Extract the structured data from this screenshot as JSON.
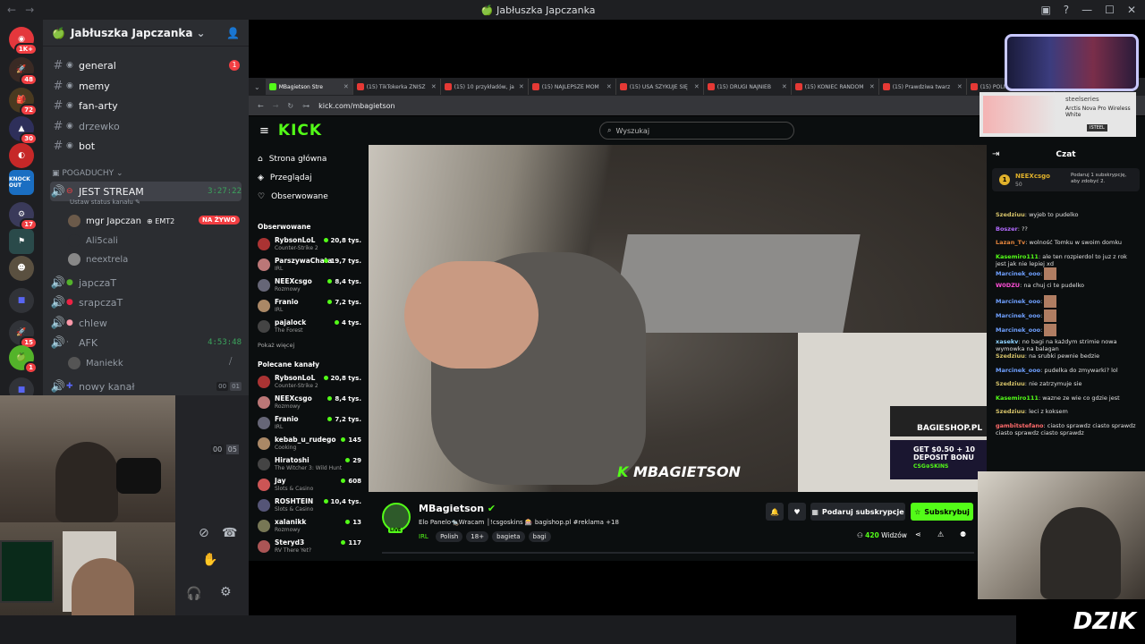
{
  "window": {
    "title": "🍏 Jabłuszka Japczanka"
  },
  "rail": {
    "badges": [
      "1K+",
      "48",
      "72",
      "30",
      "17",
      "15",
      "1"
    ],
    "knockout_label": "KNOCK OUT"
  },
  "server": {
    "name": "Jabłuszka Japczanka",
    "channels": [
      {
        "name": "general",
        "badge": "1"
      },
      {
        "name": "memy"
      },
      {
        "name": "fan-arty"
      },
      {
        "name": "drzewko"
      },
      {
        "name": "bot"
      }
    ],
    "category": "POGADUCHY",
    "voice_channels": [
      {
        "name": "JEST STREAM",
        "time": "3:27:22",
        "status": "Ustaw status kanału"
      },
      {
        "name": "japczaT"
      },
      {
        "name": "srapczaT"
      },
      {
        "name": "chlew"
      },
      {
        "name": "AFK",
        "time": "4:53:48"
      },
      {
        "name": "nowy kanał",
        "limit_a": "00",
        "limit_b": "01"
      }
    ],
    "voice_users": [
      {
        "name": "mgr Japczan",
        "tag": "EMT2",
        "live": "NA ŻYWO"
      },
      {
        "name": "Ali5cali"
      },
      {
        "name": "neextrela"
      }
    ],
    "afk_user": "Maniekk",
    "extra_limit_a": "00",
    "extra_limit_b": "05"
  },
  "browser": {
    "tabs": [
      "MBagietson Stre",
      "(15) TikTokerka ZNISZ",
      "(15) 10 przykładów, ja",
      "(15) NAJLEPSZE MOM",
      "(15) USA SZYKUJE SIĘ",
      "(15) DRUGI NAJNIEB",
      "(15) KONIEC RANDOM",
      "(15) Prawdziwa twarz",
      "(15) POLICJA"
    ],
    "url": "kick.com/mbagietson"
  },
  "kick": {
    "logo": "KICK",
    "search_placeholder": "Wyszukaj",
    "nav": [
      "Strona główna",
      "Przeglądaj",
      "Obserwowane"
    ],
    "followed_title": "Obserwowane",
    "followed": [
      {
        "name": "RybsonLoL",
        "cat": "Counter-Strike 2",
        "viewers": "20,8 tys."
      },
      {
        "name": "ParszywaChata",
        "cat": "IRL",
        "viewers": "19,7 tys."
      },
      {
        "name": "NEEXcsgo",
        "cat": "Rozmowy",
        "viewers": "8,4 tys."
      },
      {
        "name": "Franio",
        "cat": "IRL",
        "viewers": "7,2 tys."
      },
      {
        "name": "pajalock",
        "cat": "The Forest",
        "viewers": "4 tys."
      }
    ],
    "show_more": "Pokaż więcej",
    "recommended_title": "Polecane kanały",
    "recommended": [
      {
        "name": "RybsonLoL",
        "cat": "Counter-Strike 2",
        "viewers": "20,8 tys."
      },
      {
        "name": "NEEXcsgo",
        "cat": "Rozmowy",
        "viewers": "8,4 tys."
      },
      {
        "name": "Franio",
        "cat": "IRL",
        "viewers": "7,2 tys."
      },
      {
        "name": "kebab_u_rudego",
        "cat": "Cooking",
        "viewers": "145"
      },
      {
        "name": "Hiratoshi",
        "cat": "The Witcher 3: Wild Hunt",
        "viewers": "29"
      },
      {
        "name": "Jay",
        "cat": "Slots & Casino",
        "viewers": "608"
      },
      {
        "name": "ROSHTEIN",
        "cat": "Slots & Casino",
        "viewers": "10,4 tys."
      },
      {
        "name": "xalanikk",
        "cat": "Rozmowy",
        "viewers": "13"
      },
      {
        "name": "Steryd3",
        "cat": "RV There Yet?",
        "viewers": "117"
      }
    ],
    "video_watermark": "MBAGIETSON",
    "ad_shop": "BAGIESHOP.PL",
    "ad_promo": "GET $0.50 + 10 DEPOSIT BONU",
    "ad_brand": "CSG⊕SKINS",
    "streamer": {
      "name": "MBagietson",
      "live": "LIVE",
      "title": "Elo Panelo🐀Wracam │!csgoskins 🎰 bagishop.pl #reklama +18",
      "category": "IRL",
      "tags": [
        "Polish",
        "18+",
        "bagieta",
        "bagi"
      ],
      "viewers": "420",
      "viewers_label": "Widzów",
      "gift_label": "Podaruj subskrypcje",
      "sub_label": "Subskrybuj"
    },
    "chat": {
      "title": "Czat",
      "pinned_user": "NEEXcsgo",
      "pinned_rank": "1",
      "pinned_count": "50",
      "pinned_text": "Podaruj 1 subskrypcję, aby zdobyć 2.",
      "messages": [
        {
          "user": "Szedziuu",
          "color": "#d7c46a",
          "text": "wyjeb to pudelko"
        },
        {
          "user": "Boszer",
          "color": "#b36bff",
          "text": "??"
        },
        {
          "user": "Lazan_Tv",
          "color": "#e2843c",
          "text": "wolność Tomku w swoim domku"
        },
        {
          "user": "Kasemiro111",
          "color": "#53fc18",
          "text": "ale ten rozpierdol to juz z rok jest jak nie lepiej xd"
        },
        {
          "user": "Marcinek_ooo",
          "color": "#6fa0ff",
          "text": ""
        },
        {
          "user": "W0DZU",
          "color": "#ff4fd8",
          "text": "na chuj ci te pudelko"
        },
        {
          "user": "Marcinek_ooo",
          "color": "#6fa0ff",
          "text": ""
        },
        {
          "user": "Marcinek_ooo",
          "color": "#6fa0ff",
          "text": ""
        },
        {
          "user": "Marcinek_ooo",
          "color": "#6fa0ff",
          "text": ""
        },
        {
          "user": "xasekv",
          "color": "#8fd3ff",
          "text": "no bagi na każdym strimie nowa wymowka na balagan"
        },
        {
          "user": "Szedziuu",
          "color": "#d7c46a",
          "text": "na srubki pewnie bedzie"
        },
        {
          "user": "Marcinek_ooo",
          "color": "#6fa0ff",
          "text": "pudelka do zmywarki? lol"
        },
        {
          "user": "Szedziuu",
          "color": "#d7c46a",
          "text": "nie zatrzymuje sie"
        },
        {
          "user": "Kasemiro111",
          "color": "#53fc18",
          "text": "wazne ze wie co gdzie jest"
        },
        {
          "user": "Szedziuu",
          "color": "#d7c46a",
          "text": "leci z koksem"
        },
        {
          "user": "gambitstefano",
          "color": "#ff6b6b",
          "text": "ciasto sprawdz ciasto sprawdz ciasto sprawdz ciasto sprawdz"
        }
      ]
    }
  },
  "overlay": {
    "ad_brand": "steelseries",
    "ad_product": "Arctis Nova Pro Wireless White",
    "ad_code": "ISTEEL",
    "logo": "DZIK"
  }
}
